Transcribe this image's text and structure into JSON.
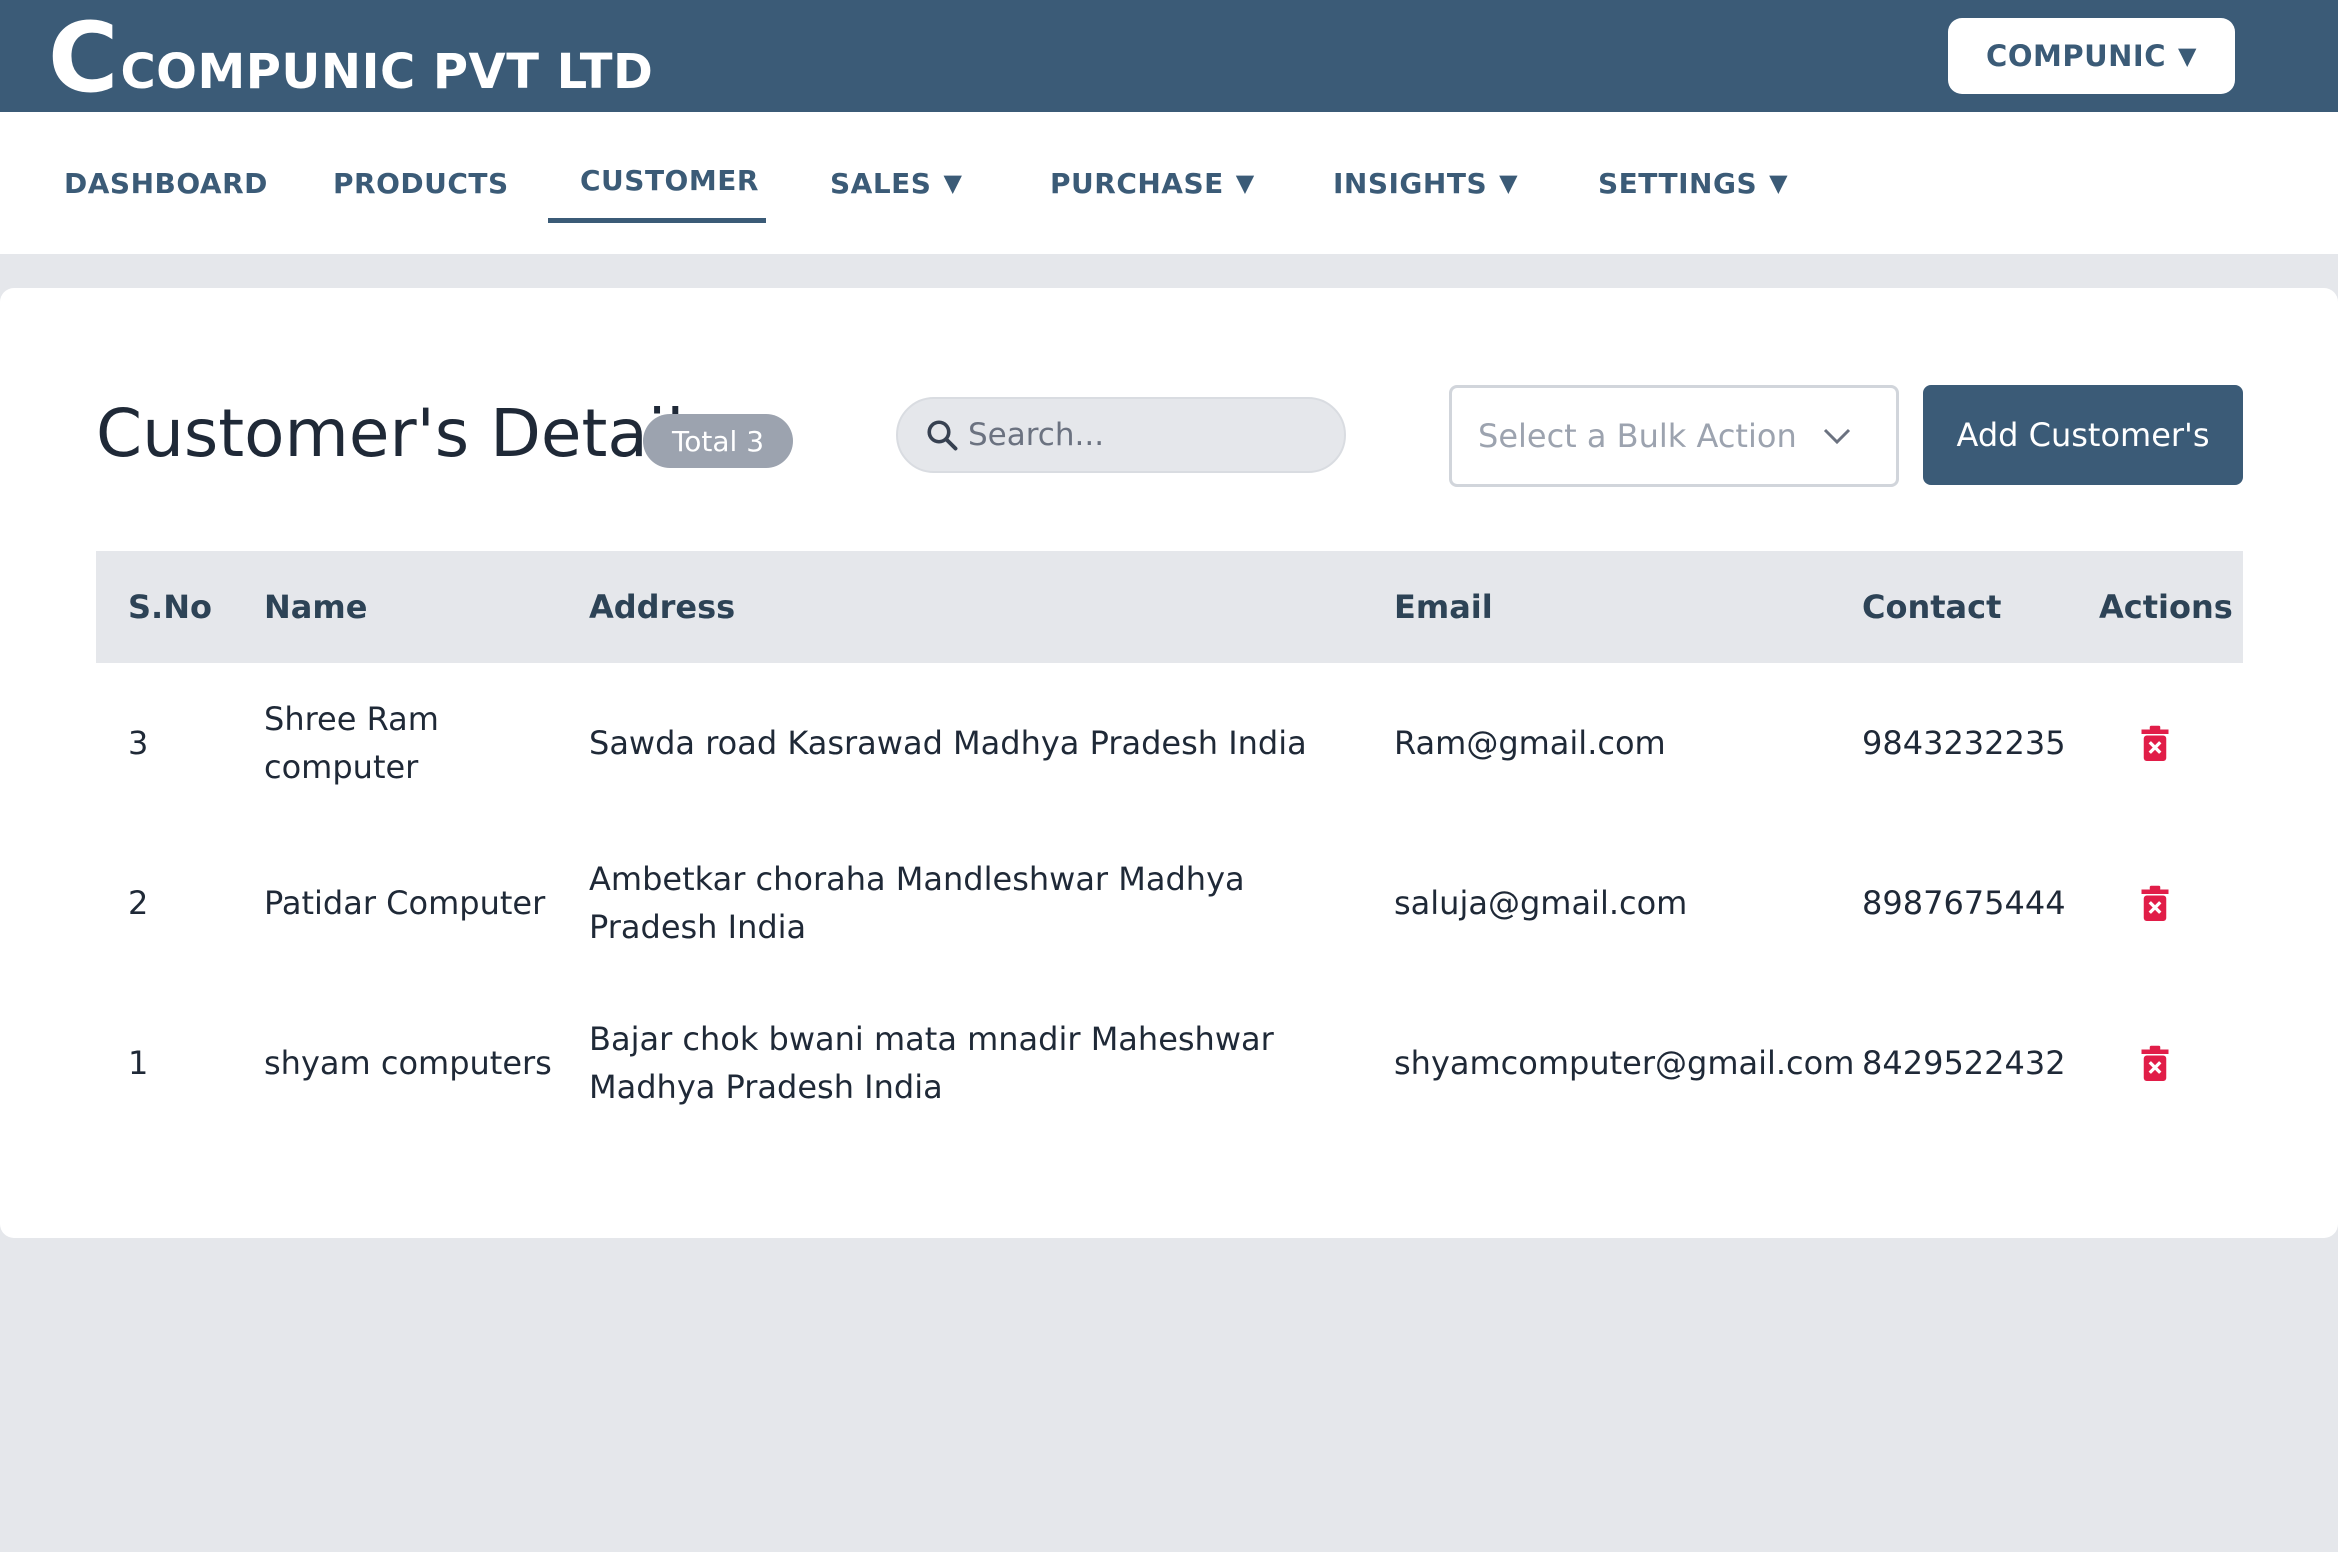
{
  "header": {
    "logo_letter": "C",
    "company_name": "COMPUNIC PVT LTD",
    "account_menu_label": "COMPUNIC",
    "account_menu_caret": "▼"
  },
  "nav": {
    "items": [
      {
        "label": "DASHBOARD",
        "caret": ""
      },
      {
        "label": "PRODUCTS",
        "caret": ""
      },
      {
        "label": "CUSTOMER",
        "caret": "",
        "active": true
      },
      {
        "label": "SALES",
        "caret": "▼"
      },
      {
        "label": "PURCHASE",
        "caret": "▼"
      },
      {
        "label": "INSIGHTS",
        "caret": "▼"
      },
      {
        "label": "SETTINGS",
        "caret": "▼"
      }
    ]
  },
  "page": {
    "title": "Customer's Details",
    "total_badge": "Total 3",
    "search_placeholder": "Search...",
    "bulk_action_placeholder": "Select a Bulk Action",
    "add_button_label": "Add Customer's"
  },
  "table": {
    "columns": [
      "S.No",
      "Name",
      "Address",
      "Email",
      "Contact",
      "Actions"
    ],
    "rows": [
      {
        "sno": "3",
        "name": "Shree Ram computer",
        "address": "Sawda road Kasrawad Madhya Pradesh India",
        "email": "Ram@gmail.com",
        "contact": "9843232235",
        "action_icon": "trash-icon"
      },
      {
        "sno": "2",
        "name": "Patidar Computer",
        "address": "Ambetkar choraha Mandleshwar Madhya Pradesh India",
        "email": "saluja@gmail.com",
        "contact": "8987675444",
        "action_icon": "trash-icon"
      },
      {
        "sno": "1",
        "name": "shyam computers",
        "address": "Bajar chok bwani mata mnadir Maheshwar Madhya Pradesh India",
        "email": "shyamcomputer@gmail.com",
        "contact": "8429522432",
        "action_icon": "trash-icon"
      }
    ]
  },
  "colors": {
    "brand": "#3b5b77",
    "page_bg": "#e5e7eb",
    "delete": "#e11d48"
  }
}
